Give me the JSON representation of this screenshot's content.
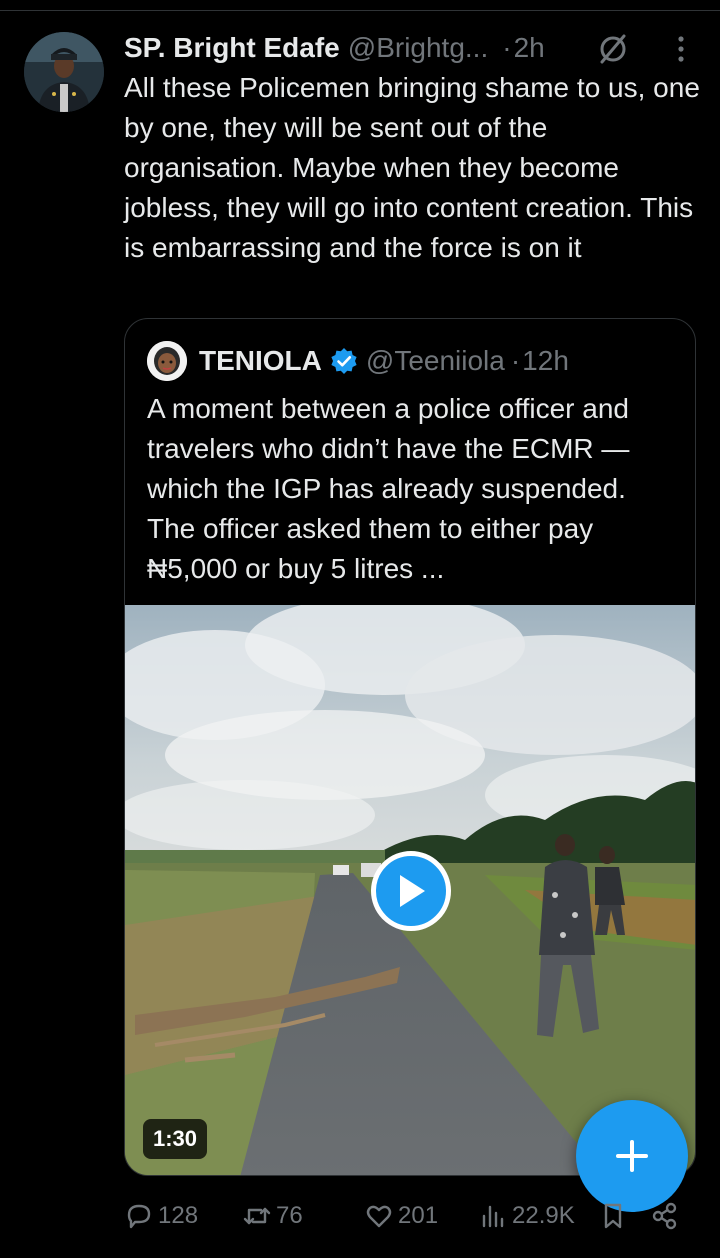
{
  "tweet": {
    "author_name": "SP. Bright Edafe",
    "author_handle": "@Brightg...",
    "separator": "·",
    "time": "2h",
    "text": "All these Policemen bringing shame to us, one by one, they will be sent out of the organisation. Maybe when they become jobless, they will go into content creation. This is embarrassing and the force is on it"
  },
  "quote": {
    "author_name": "TENIOLA",
    "author_handle": "@Teeniiola",
    "separator": "·",
    "time": "12h",
    "text": "A moment between a police officer and travelers who didn’t have the ECMR — which the IGP has already suspended. The officer asked them to either pay ₦5,000 or buy 5 litres ...",
    "video_duration": "1:30"
  },
  "actions": {
    "replies": "128",
    "reposts": "76",
    "likes": "201",
    "views": "22.9K"
  },
  "icons": {
    "reply": "reply-icon",
    "repost": "repost-icon",
    "like": "heart-icon",
    "views": "views-icon",
    "bookmark": "bookmark-icon",
    "share": "share-icon",
    "grok": "grok-icon",
    "more": "more-icon",
    "verified": "verified-icon",
    "play": "play-icon",
    "compose": "plus-icon"
  },
  "colors": {
    "background": "#000000",
    "text": "#e7e9ea",
    "muted": "#71767b",
    "accent": "#1d9bf0",
    "border": "#2f3336"
  }
}
